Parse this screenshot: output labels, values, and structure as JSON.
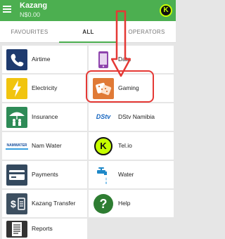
{
  "header": {
    "title": "Kazang",
    "balance": "N$0.00",
    "logo_letter": "K"
  },
  "tabs": [
    {
      "label": "FAVOURITES",
      "selected": false
    },
    {
      "label": "ALL",
      "selected": true
    },
    {
      "label": "OPERATORS",
      "selected": false
    }
  ],
  "services": [
    {
      "label": "Airtime",
      "icon": "phone-icon"
    },
    {
      "label": "Data",
      "icon": "smartphone-icon"
    },
    {
      "label": "Electricity",
      "icon": "lightning-icon"
    },
    {
      "label": "Gaming",
      "icon": "dice-icon"
    },
    {
      "label": "Insurance",
      "icon": "umbrella-family-icon"
    },
    {
      "label": "DStv Namibia",
      "icon": "dstv-logo-icon",
      "logo_text": "DStv"
    },
    {
      "label": "Nam Water",
      "icon": "namwater-logo-icon",
      "logo_text": "NAMWATER"
    },
    {
      "label": "Tel.io",
      "icon": "k-logo-icon",
      "logo_text": "K"
    },
    {
      "label": "Payments",
      "icon": "card-icon"
    },
    {
      "label": "Water",
      "icon": "tap-icon"
    },
    {
      "label": "Kazang Transfer",
      "icon": "money-transfer-icon"
    },
    {
      "label": "Help",
      "icon": "question-icon",
      "logo_text": "?"
    },
    {
      "label": "Reports",
      "icon": "report-icon"
    }
  ],
  "annotation": {
    "color": "#e53935",
    "highlighted_item": "Gaming"
  },
  "colors": {
    "accent": "#4caf50"
  }
}
